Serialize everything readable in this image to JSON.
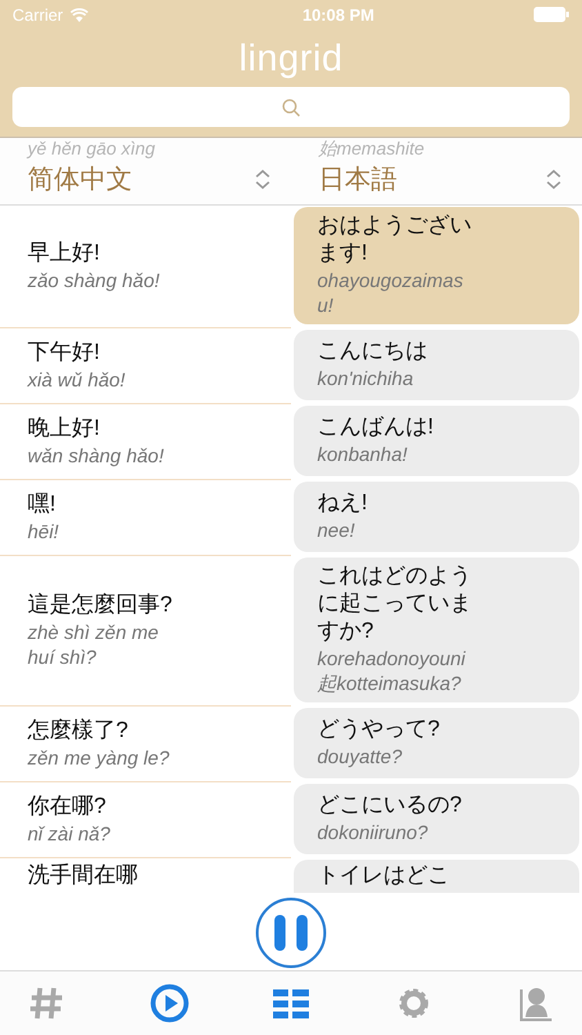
{
  "status_bar": {
    "carrier": "Carrier",
    "time": "10:08 PM"
  },
  "app_title": "lingrid",
  "language_bar": {
    "peek_left": "yě hěn gāo xìng",
    "peek_right": "始memashite",
    "left_language": "简体中文",
    "right_language": "日本語"
  },
  "phrases": [
    {
      "zh": "早上好!",
      "pinyin": "zǎo shàng hǎo!",
      "ja": "おはようございます!",
      "romaji": "ohayougozaimasu!",
      "selected": true
    },
    {
      "zh": "下午好!",
      "pinyin": "xià wǔ hǎo!",
      "ja": "こんにちは",
      "romaji": "kon'nichiha",
      "selected": false
    },
    {
      "zh": "晚上好!",
      "pinyin": "wǎn shàng hǎo!",
      "ja": "こんばんは!",
      "romaji": "konbanha!",
      "selected": false
    },
    {
      "zh": "嘿!",
      "pinyin": "hēi!",
      "ja": "ねえ!",
      "romaji": "nee!",
      "selected": false
    },
    {
      "zh": "這是怎麼回事?",
      "pinyin": "zhè shì zěn me huí shì?",
      "ja": "これはどのように起こっていますか?",
      "romaji": "korehadonoyouni起kotteimasuka?",
      "selected": false
    },
    {
      "zh": "怎麼樣了?",
      "pinyin": "zěn me yàng le?",
      "ja": "どうやって?",
      "romaji": "douyatte?",
      "selected": false
    },
    {
      "zh": "你在哪?",
      "pinyin": "nǐ zài nǎ?",
      "ja": "どこにいるの?",
      "romaji": "dokoniiruno?",
      "selected": false
    },
    {
      "zh": "洗手間在哪",
      "ja": "トイレはどこ",
      "selected": false
    }
  ],
  "tabs": [
    {
      "kind": "hash",
      "active": false
    },
    {
      "kind": "play",
      "active": true
    },
    {
      "kind": "grid",
      "active": true
    },
    {
      "kind": "gear",
      "active": false
    },
    {
      "kind": "profile",
      "active": false
    }
  ],
  "player": {
    "playing": true
  }
}
